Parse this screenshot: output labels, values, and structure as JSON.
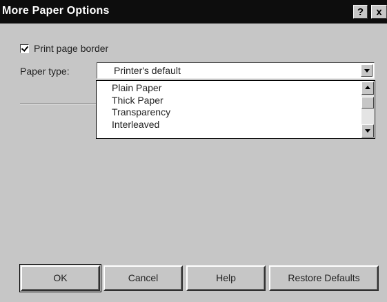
{
  "window": {
    "title": "More Paper Options",
    "help_glyph": "?",
    "close_glyph": "x"
  },
  "options": {
    "print_border_label": "Print page border",
    "print_border_checked": true,
    "paper_type_label": "Paper type:",
    "paper_type_value": "Printer's default"
  },
  "dropdown": {
    "items": [
      "Plain Paper",
      "Thick Paper",
      "Transparency",
      "Interleaved"
    ]
  },
  "buttons": {
    "ok": "OK",
    "cancel": "Cancel",
    "help": "Help",
    "restore": "Restore Defaults"
  }
}
